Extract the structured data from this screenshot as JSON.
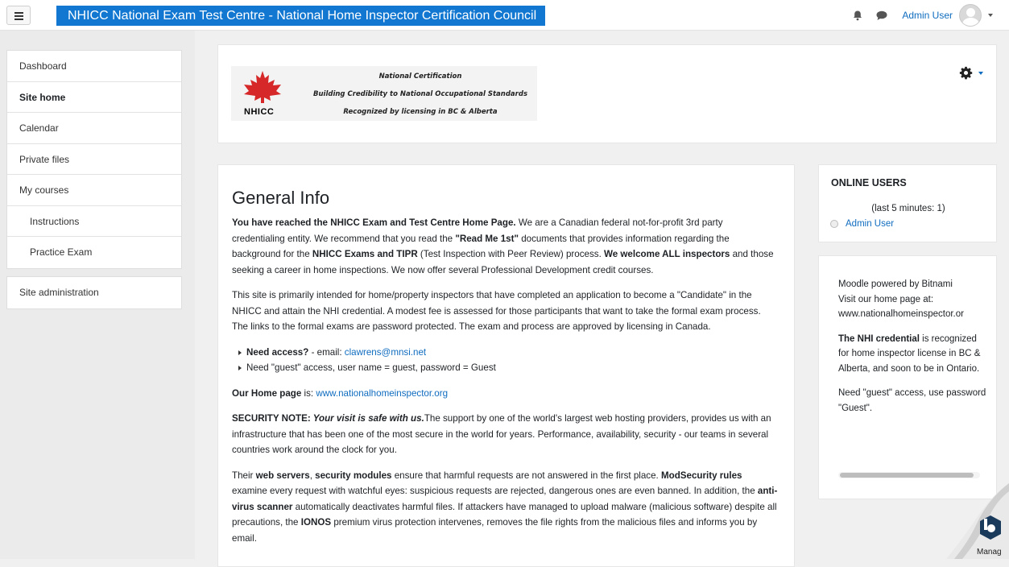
{
  "navbar": {
    "site_title": "NHICC National Exam Test Centre - National Home Inspector Certification Council",
    "user_name": "Admin User",
    "icons": [
      "hamburger-menu-icon",
      "bell-icon",
      "chat-icon",
      "user-avatar-icon",
      "chevron-down-icon"
    ]
  },
  "drawer": {
    "group1": [
      {
        "label": "Dashboard"
      },
      {
        "label": "Site home"
      },
      {
        "label": "Calendar"
      },
      {
        "label": "Private files"
      },
      {
        "label": "My courses"
      },
      {
        "label": "Instructions"
      },
      {
        "label": "Practice Exam"
      }
    ],
    "group2": [
      {
        "label": "Site administration"
      }
    ]
  },
  "header": {
    "banner_abbr": "NHICC",
    "banner_line1": "National Certification",
    "banner_line2": "Building Credibility to National Occupational Standards",
    "banner_line3": "Recognized by licensing in BC & Alberta",
    "icons": [
      "maple-leaf-icon",
      "gear-icon"
    ]
  },
  "main": {
    "heading": "General Info",
    "p1_b1": "You have reached the NHICC Exam and Test Centre Home Page.",
    "p1_t1": " We are a Canadian federal not-for-profit 3rd party credentialing entity. We recommend that you read the ",
    "p1_b2": "\"Read Me 1st\"",
    "p1_t2": " documents that provides information regarding the background for the ",
    "p1_b3": "NHICC Exams and TIPR",
    "p1_t3": " (Test Inspection with Peer Review) process. ",
    "p1_b4": "We welcome ALL inspectors",
    "p1_t4": " and those seeking a career in home inspections. We now offer several Professional Development credit courses.",
    "p2": "This site is primarily intended for home/property inspectors that have completed an application to become a \"Candidate\" in the NHICC and attain the NHI credential. A modest fee is assessed for those participants that want to take the formal exam process. The links to the formal exams are password protected. The exam and process are approved by licensing in Canada.",
    "li1_b": "Need access?",
    "li1_t": " - email: ",
    "li1_link": "clawrens@mnsi.net",
    "li2": "Need \"guest\" access, user name = guest, password = Guest",
    "home_b": "Our Home page",
    "home_t": " is: ",
    "home_link": "www.nationalhomeinspector.org",
    "sec_b": "SECURITY NOTE:",
    "sec_bi": " Your visit is safe with us.",
    "sec_t": "The support by one of the world's largest web hosting providers, provides us with an infrastructure that has been one of the most secure in the world for years. Performance, availability, security - our teams in several countries work around the clock for you.",
    "p5_t1": "Their ",
    "p5_b1": "web servers",
    "p5_t2": ", ",
    "p5_b2": "security modules",
    "p5_t3": " ensure that harmful requests are not answered in the first place. ",
    "p5_b3": "ModSecurity rules",
    "p5_t4": " examine every request with watchful eyes: suspicious requests are rejected, dangerous ones are even banned. In addition, the ",
    "p5_b4": "anti-virus scanner",
    "p5_t5": " automatically deactivates harmful files. If attackers have managed to upload malware (malicious software) despite all precautions, the ",
    "p5_b5": "IONOS",
    "p5_t6": " premium virus protection intervenes, removes the file rights from the malicious files and informs you by email."
  },
  "online_users": {
    "title": "ONLINE USERS",
    "subtitle": "(last 5 minutes: 1)",
    "user": "Admin User"
  },
  "html_block": {
    "line1": "Moodle powered by Bitnami",
    "line2": "Visit our home page at:",
    "line3": "www.nationalhomeinspector.or",
    "cred_b": "The NHI credential",
    "cred_t": " is recognized for home inspector license in BC & Alberta, and soon to be in Ontario.",
    "guest": "Need \"guest\" access, use password \"Guest\"."
  },
  "corner": {
    "label": "Manag"
  }
}
